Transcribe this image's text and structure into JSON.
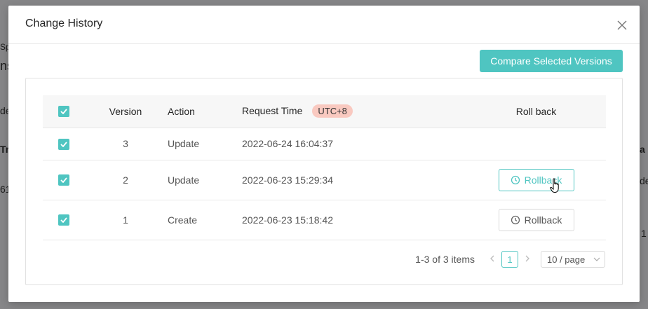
{
  "background": {
    "fragments": [
      "Sp",
      "ns",
      "de",
      "Tra",
      "61",
      "a :",
      "de",
      "1"
    ]
  },
  "modal": {
    "title": "Change History",
    "compare_label": "Compare Selected Versions",
    "table": {
      "headers": {
        "version": "Version",
        "action": "Action",
        "request_time": "Request Time",
        "timezone_badge": "UTC+8",
        "rollback": "Roll back"
      },
      "rows": [
        {
          "version": "3",
          "action": "Update",
          "time": "2022-06-24 16:04:37",
          "rollback_label": "",
          "checked": true
        },
        {
          "version": "2",
          "action": "Update",
          "time": "2022-06-23 15:29:34",
          "rollback_label": "Rollback",
          "checked": true
        },
        {
          "version": "1",
          "action": "Create",
          "time": "2022-06-23 15:18:42",
          "rollback_label": "Rollback",
          "checked": true
        }
      ]
    },
    "pagination": {
      "total_text": "1-3 of 3 items",
      "current_page": "1",
      "page_size": "10 / page"
    }
  },
  "colors": {
    "accent": "#4fc5c1",
    "badge_bg": "#f9c9c0"
  }
}
